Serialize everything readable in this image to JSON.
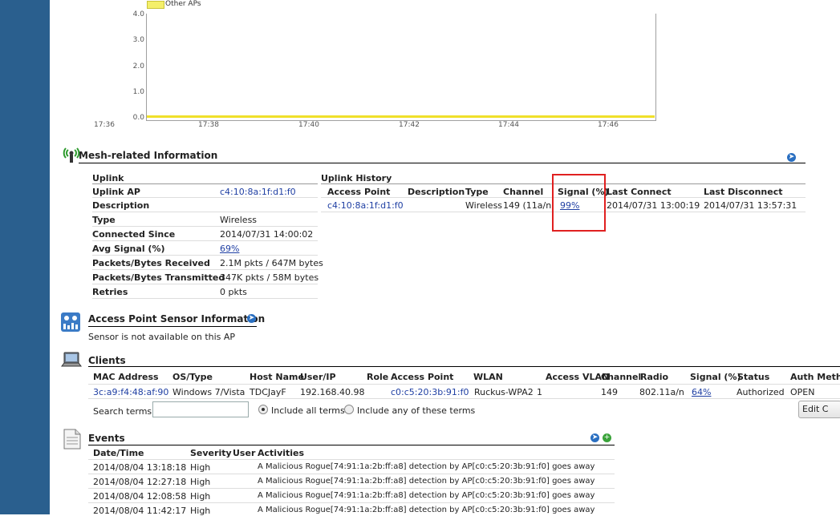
{
  "chart": {
    "legend_label": "Other APs",
    "y_ticks": [
      "4.0",
      "3.0",
      "2.0",
      "1.0",
      "0.0"
    ],
    "x_ticks": [
      "17:36",
      "17:38",
      "17:40",
      "17:42",
      "17:44",
      "17:46"
    ],
    "series_color": "#f0e02a"
  },
  "mesh": {
    "title": "Mesh-related Information",
    "uplink_header": "Uplink",
    "rows": [
      {
        "label": "Uplink AP",
        "value": "c4:10:8a:1f:d1:f0"
      },
      {
        "label": "Description",
        "value": ""
      },
      {
        "label": "Type",
        "value": "Wireless"
      },
      {
        "label": "Connected Since",
        "value": "2014/07/31  14:00:02"
      },
      {
        "label": "Avg Signal (%)",
        "value": "69%"
      },
      {
        "label": "Packets/Bytes Received",
        "value": "2.1M pkts / 647M bytes"
      },
      {
        "label": "Packets/Bytes Transmitted",
        "value": "347K pkts / 58M bytes"
      },
      {
        "label": "Retries",
        "value": "0 pkts"
      }
    ],
    "history_header": "Uplink History",
    "history_cols": [
      "Access Point",
      "Description",
      "Type",
      "Channel",
      "Signal (%)",
      "Last Connect",
      "Last Disconnect"
    ],
    "history_row": {
      "ap": "c4:10:8a:1f:d1:f0",
      "description": "",
      "type": "Wireless",
      "channel": "149 (11a/n)",
      "signal": "99%",
      "last_connect": "2014/07/31  13:00:19",
      "last_disconnect": "2014/07/31  13:57:31"
    }
  },
  "sensor": {
    "title": "Access Point Sensor Information",
    "message": "Sensor is not available on this AP"
  },
  "clients": {
    "title": "Clients",
    "cols": [
      "MAC Address",
      "OS/Type",
      "Host Name",
      "User/IP",
      "Role",
      "Access Point",
      "WLAN",
      "Access VLAN",
      "Channel",
      "Radio",
      "Signal (%)",
      "Status",
      "Auth Meth"
    ],
    "row": {
      "mac": "3c:a9:f4:48:af:90",
      "os": "Windows 7/Vista",
      "host": "TDCJayF",
      "ip": "192.168.40.98",
      "role": "",
      "ap": "c0:c5:20:3b:91:f0",
      "wlan": "Ruckus-WPA2",
      "vlan": "1",
      "channel": "149",
      "radio": "802.11a/n",
      "signal": "64%",
      "status": "Authorized",
      "auth": "OPEN"
    },
    "search_label": "Search terms",
    "search_value": "",
    "radio_all": "Include all terms",
    "radio_any": "Include any of these terms",
    "edit_button": "Edit C"
  },
  "events": {
    "title": "Events",
    "cols": [
      "Date/Time",
      "Severity",
      "User",
      "Activities"
    ],
    "rows": [
      {
        "date": "2014/08/04  13:18:18",
        "severity": "High",
        "user": "",
        "activity": "A Malicious Rogue[74:91:1a:2b:ff:a8] detection by AP[c0:c5:20:3b:91:f0] goes away"
      },
      {
        "date": "2014/08/04  12:27:18",
        "severity": "High",
        "user": "",
        "activity": "A Malicious Rogue[74:91:1a:2b:ff:a8] detection by AP[c0:c5:20:3b:91:f0] goes away"
      },
      {
        "date": "2014/08/04  12:08:58",
        "severity": "High",
        "user": "",
        "activity": "A Malicious Rogue[74:91:1a:2b:ff:a8] detection by AP[c0:c5:20:3b:91:f0] goes away"
      },
      {
        "date": "2014/08/04  11:42:17",
        "severity": "High",
        "user": "",
        "activity": "A Malicious Rogue[74:91:1a:2b:ff:a8] detection by AP[c0:c5:20:3b:91:f0] goes away"
      }
    ]
  }
}
